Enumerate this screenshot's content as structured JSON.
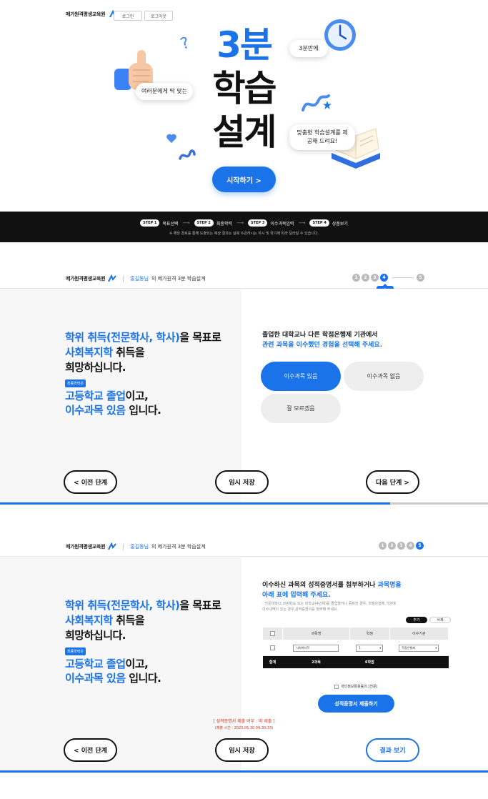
{
  "hero": {
    "brand": "메가원격평생교육원",
    "login": "로그인",
    "logout": "로그아웃",
    "title_line1": "3분",
    "title_line2": "학습",
    "title_line3": "설계",
    "bubble_left": "여러분에게 딱 맞는",
    "bubble_right_top": "3분만에",
    "bubble_right_bottom": "맞춤형 학습설계를 제공해 드려요!",
    "start": "시작하기 >"
  },
  "stepbar": {
    "steps": [
      {
        "chip": "STEP 1",
        "label": "목표선택"
      },
      {
        "chip": "STEP 2",
        "label": "최종학력"
      },
      {
        "chip": "STEP 3",
        "label": "이수과목입력"
      },
      {
        "chip": "STEP 4",
        "label": "상품보기"
      }
    ],
    "arrow": "⟶",
    "note": "※ 해당 경로를 통해 도출되는 예상 결과는 실제 수강하시는 자시 및 학기에 따라 달라질 수 있습니다."
  },
  "panel1": {
    "brand": "메가원격평생교육원",
    "user": "홍길동님",
    "title_suffix": "의 메가원격 3분 학습설계",
    "progress": [
      "1",
      "2",
      "3",
      "4",
      "5"
    ],
    "progress_active": 4,
    "tooltip": "도움말",
    "goal": {
      "l1_blue": "학위 취득(전문학사, 학사)",
      "l1_rest": "을 목표로",
      "l2_blue": "사회복지학",
      "l2_rest": " 취득을",
      "l3": "희망하십니다."
    },
    "edu_chip": "최종학력은",
    "edu": {
      "l1_blue": "고등학교 졸업",
      "l1_rest": "이고,",
      "l2_blue": "이수과목 있음",
      "l2_rest": " 입니다."
    },
    "question_l1": "졸업한 대학교나 다른 학점은행제 기관에서",
    "question_l2": "관련 과목을 이수했던 경험을 선택해 주세요.",
    "options": [
      "이수과목 있음",
      "이수과목 없음",
      "잘 모르겠음"
    ],
    "prev": "< 이전 단계",
    "save": "임시 저장",
    "next": "다음 단계 >",
    "progress_fill": 0.8
  },
  "panel2": {
    "brand": "메가원격평생교육원",
    "user": "홍길동님",
    "title_suffix": "의 메가원격 3분 학습설계",
    "progress": [
      "1",
      "2",
      "3",
      "4",
      "5"
    ],
    "progress_active": 5,
    "goal": {
      "l1_blue": "학위 취득(전문학사, 학사)",
      "l1_rest": "을 목표로",
      "l2_blue": "사회복지학",
      "l2_rest": " 취득을",
      "l3": "희망하십니다."
    },
    "edu_chip": "최종학력은",
    "edu": {
      "l1_blue": "고등학교 졸업",
      "l1_rest": "이고,",
      "l2_blue": "이수과목 있음",
      "l2_rest": " 입니다."
    },
    "question_l1a": "이수하신 과목의 성적증명서를 첨부하거나 ",
    "question_l1b": "과목명을",
    "question_l2": "아래 표에 입력해 주세요.",
    "note_l1": "- 전문대학(2,3년제)도 또는 대학교(4년제)를 졸업했거나 중퇴한 경우, 학점은행제 기관에",
    "note_l2": "  이수내역이 있는 경우 성적증명서를 첨부해 주세요.",
    "add": "추가",
    "delete": "삭제",
    "table": {
      "headers": [
        "과목명",
        "학점",
        "이수기관"
      ],
      "row": {
        "subject": "사회복지학",
        "credit": "1",
        "institution": "학점은행제"
      },
      "sum": {
        "label": "합계",
        "subjects": "2과목",
        "credits": "6학점"
      }
    },
    "agree": "개인정보활용동의 [전문]",
    "submit": "성적증명서 제출하기",
    "status": "[ 성적증명서 제출 여부 : 미 제출 ]",
    "status_time": "(제출 시간 : 2023.05.30 09:30:33)",
    "prev": "< 이전 단계",
    "save": "임시 저장",
    "result": "결과 보기",
    "progress_fill": 1.0
  },
  "colors": {
    "accent": "#1a73e8",
    "dark": "#111111",
    "error": "#d93025"
  }
}
